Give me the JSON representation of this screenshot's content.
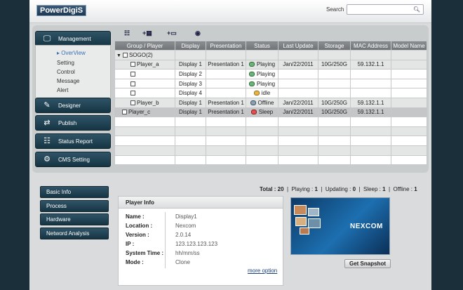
{
  "brand": {
    "logo": "PowerDigiS"
  },
  "search": {
    "label": "Search",
    "value": ""
  },
  "nav": {
    "management": "Management",
    "submenu": [
      "▸ OverView",
      "Setting",
      "Control",
      "Message",
      "Alert"
    ],
    "designer": "Designer",
    "publish": "Publish",
    "status_report": "Status Report",
    "cms_setting": "CMS Setting"
  },
  "grid": {
    "headers": [
      "Group / Player",
      "Display",
      "Presentation",
      "Status",
      "Last Update",
      "Storage",
      "MAC Address",
      "Model Name"
    ],
    "rows": [
      [
        "SOGO(2)",
        "",
        "",
        "",
        "",
        "",
        "",
        ""
      ],
      [
        "Player_a",
        "Display 1",
        "Presentation 1",
        "Playing",
        "Jan/22/2011",
        "10G/250G",
        "59.132.1.1",
        ""
      ],
      [
        "",
        "Display 2",
        "",
        "Playing",
        "",
        "",
        "",
        ""
      ],
      [
        "",
        "Display 3",
        "",
        "Playing",
        "",
        "",
        "",
        ""
      ],
      [
        "",
        "Display 4",
        "",
        "idle",
        "",
        "",
        "",
        ""
      ],
      [
        "Player_b",
        "Display 1",
        "Presentation 1",
        "Offline",
        "Jan/22/2011",
        "10G/250G",
        "59.132.1.1",
        ""
      ],
      [
        "Player_c",
        "Display 1",
        "Presentation 1",
        "Sleep",
        "Jan/22/2011",
        "10G/250G",
        "59.132.1.1",
        ""
      ]
    ]
  },
  "tabs": [
    "Basic Info",
    "Process",
    "Hardware",
    "Netword Analysis"
  ],
  "totals": {
    "total_label": "Total :",
    "total": "20",
    "playing_label": "Playing :",
    "playing": "1",
    "updating_label": "Updating :",
    "updating": "0",
    "sleep_label": "Sleep :",
    "sleep": "1",
    "offline_label": "Offline :",
    "offline": "1"
  },
  "player_info": {
    "title": "Player Info",
    "rows": [
      {
        "k": "Name :",
        "v": "Display1"
      },
      {
        "k": "Location :",
        "v": "Nexcom"
      },
      {
        "k": "Version :",
        "v": "2.0.14"
      },
      {
        "k": "IP :",
        "v": "123.123.123.123"
      },
      {
        "k": "System Time :",
        "v": "hh/mm/ss"
      },
      {
        "k": "Mode :",
        "v": "Clone"
      }
    ],
    "more": "more option"
  },
  "snapshot": {
    "logo": "NEXCOM",
    "button": "Get Snapshot"
  }
}
